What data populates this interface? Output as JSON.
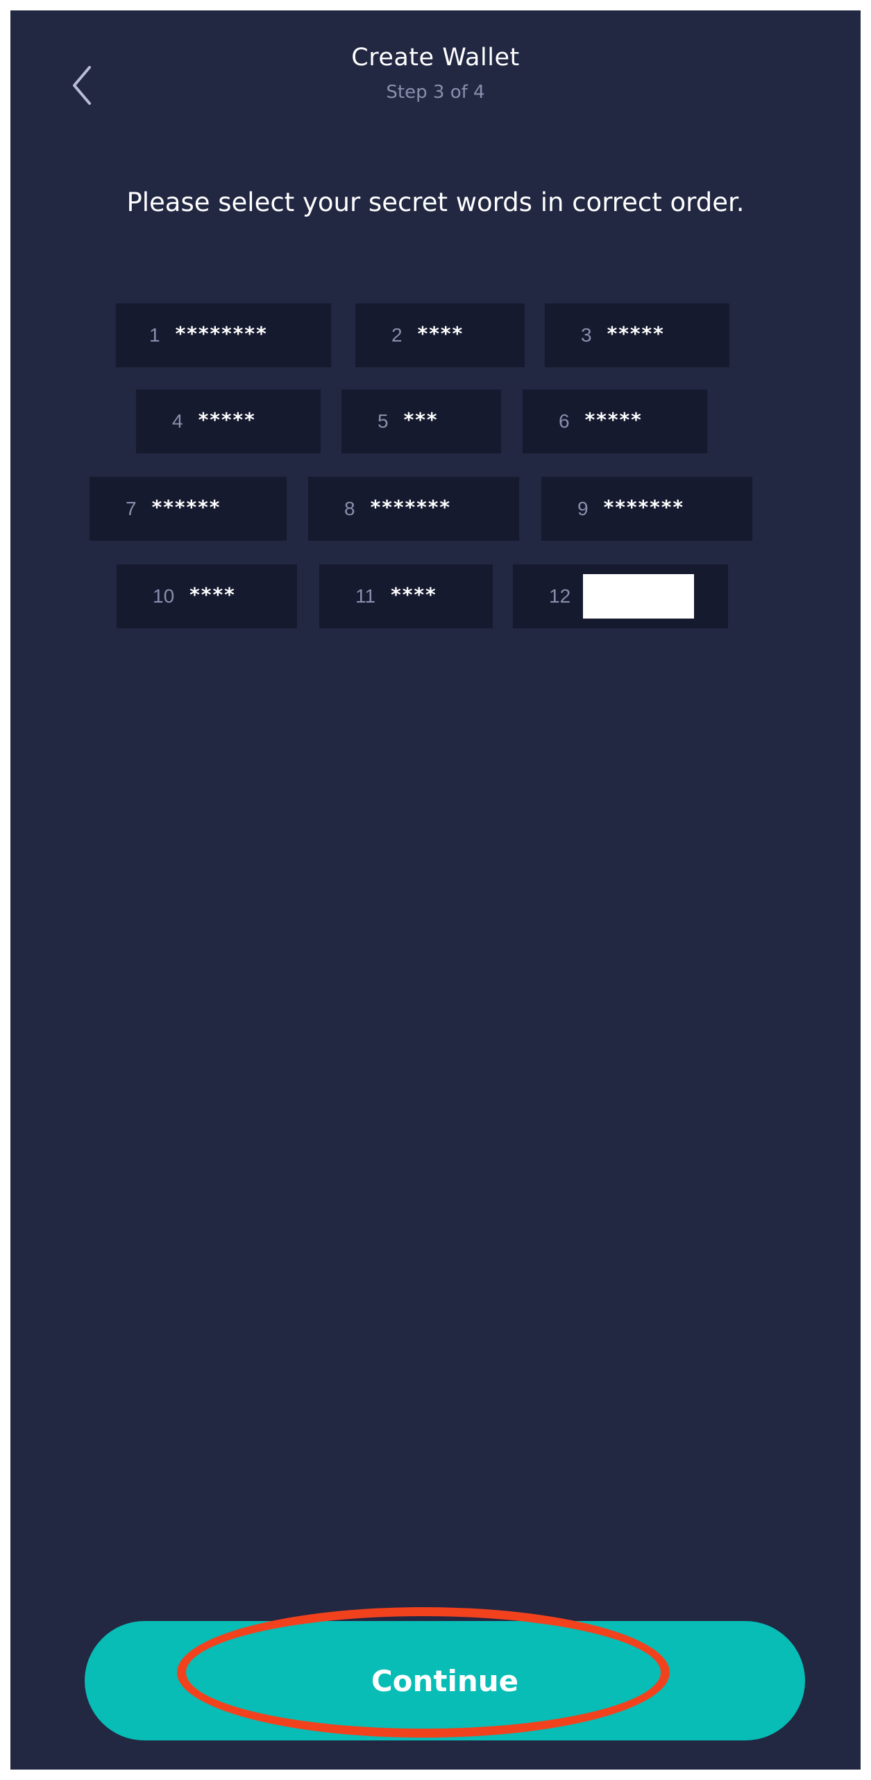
{
  "header": {
    "title": "Create Wallet",
    "step": "Step 3 of 4"
  },
  "instruction": "Please select your secret words in correct order.",
  "words": [
    {
      "num": "1",
      "masked": "********"
    },
    {
      "num": "2",
      "masked": "****"
    },
    {
      "num": "3",
      "masked": "*****"
    },
    {
      "num": "4",
      "masked": "*****"
    },
    {
      "num": "5",
      "masked": "***"
    },
    {
      "num": "6",
      "masked": "*****"
    },
    {
      "num": "7",
      "masked": "******"
    },
    {
      "num": "8",
      "masked": "*******"
    },
    {
      "num": "9",
      "masked": "*******"
    },
    {
      "num": "10",
      "masked": "****"
    },
    {
      "num": "11",
      "masked": "****"
    },
    {
      "num": "12",
      "masked": ""
    }
  ],
  "footer": {
    "continue_label": "Continue"
  },
  "colors": {
    "background": "#222742",
    "word_tile": "#161a2f",
    "accent": "#07bdb6",
    "highlight": "#f2421d"
  }
}
